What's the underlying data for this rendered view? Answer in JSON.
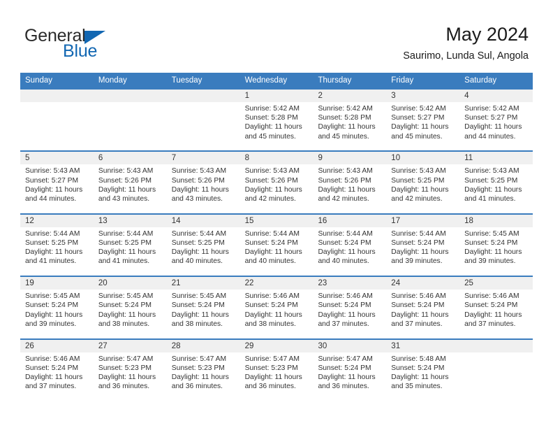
{
  "brand": {
    "name_part1": "General",
    "name_part2": "Blue",
    "triangle_icon": "triangle-icon",
    "color_primary": "#1267b2",
    "color_text": "#2b2b2b"
  },
  "header": {
    "title": "May 2024",
    "subtitle": "Saurimo, Lunda Sul, Angola"
  },
  "theme": {
    "header_row_bg": "#3a7cbe",
    "day_band_bg": "#f0f0f0",
    "text_color": "#333333"
  },
  "weekdays": [
    "Sunday",
    "Monday",
    "Tuesday",
    "Wednesday",
    "Thursday",
    "Friday",
    "Saturday"
  ],
  "weeks": [
    [
      {
        "day": "",
        "sunrise": "",
        "sunset": "",
        "daylight_line1": "",
        "daylight_line2": ""
      },
      {
        "day": "",
        "sunrise": "",
        "sunset": "",
        "daylight_line1": "",
        "daylight_line2": ""
      },
      {
        "day": "",
        "sunrise": "",
        "sunset": "",
        "daylight_line1": "",
        "daylight_line2": ""
      },
      {
        "day": "1",
        "sunrise": "Sunrise: 5:42 AM",
        "sunset": "Sunset: 5:28 PM",
        "daylight_line1": "Daylight: 11 hours",
        "daylight_line2": "and 45 minutes."
      },
      {
        "day": "2",
        "sunrise": "Sunrise: 5:42 AM",
        "sunset": "Sunset: 5:28 PM",
        "daylight_line1": "Daylight: 11 hours",
        "daylight_line2": "and 45 minutes."
      },
      {
        "day": "3",
        "sunrise": "Sunrise: 5:42 AM",
        "sunset": "Sunset: 5:27 PM",
        "daylight_line1": "Daylight: 11 hours",
        "daylight_line2": "and 45 minutes."
      },
      {
        "day": "4",
        "sunrise": "Sunrise: 5:42 AM",
        "sunset": "Sunset: 5:27 PM",
        "daylight_line1": "Daylight: 11 hours",
        "daylight_line2": "and 44 minutes."
      }
    ],
    [
      {
        "day": "5",
        "sunrise": "Sunrise: 5:43 AM",
        "sunset": "Sunset: 5:27 PM",
        "daylight_line1": "Daylight: 11 hours",
        "daylight_line2": "and 44 minutes."
      },
      {
        "day": "6",
        "sunrise": "Sunrise: 5:43 AM",
        "sunset": "Sunset: 5:26 PM",
        "daylight_line1": "Daylight: 11 hours",
        "daylight_line2": "and 43 minutes."
      },
      {
        "day": "7",
        "sunrise": "Sunrise: 5:43 AM",
        "sunset": "Sunset: 5:26 PM",
        "daylight_line1": "Daylight: 11 hours",
        "daylight_line2": "and 43 minutes."
      },
      {
        "day": "8",
        "sunrise": "Sunrise: 5:43 AM",
        "sunset": "Sunset: 5:26 PM",
        "daylight_line1": "Daylight: 11 hours",
        "daylight_line2": "and 42 minutes."
      },
      {
        "day": "9",
        "sunrise": "Sunrise: 5:43 AM",
        "sunset": "Sunset: 5:26 PM",
        "daylight_line1": "Daylight: 11 hours",
        "daylight_line2": "and 42 minutes."
      },
      {
        "day": "10",
        "sunrise": "Sunrise: 5:43 AM",
        "sunset": "Sunset: 5:25 PM",
        "daylight_line1": "Daylight: 11 hours",
        "daylight_line2": "and 42 minutes."
      },
      {
        "day": "11",
        "sunrise": "Sunrise: 5:43 AM",
        "sunset": "Sunset: 5:25 PM",
        "daylight_line1": "Daylight: 11 hours",
        "daylight_line2": "and 41 minutes."
      }
    ],
    [
      {
        "day": "12",
        "sunrise": "Sunrise: 5:44 AM",
        "sunset": "Sunset: 5:25 PM",
        "daylight_line1": "Daylight: 11 hours",
        "daylight_line2": "and 41 minutes."
      },
      {
        "day": "13",
        "sunrise": "Sunrise: 5:44 AM",
        "sunset": "Sunset: 5:25 PM",
        "daylight_line1": "Daylight: 11 hours",
        "daylight_line2": "and 41 minutes."
      },
      {
        "day": "14",
        "sunrise": "Sunrise: 5:44 AM",
        "sunset": "Sunset: 5:25 PM",
        "daylight_line1": "Daylight: 11 hours",
        "daylight_line2": "and 40 minutes."
      },
      {
        "day": "15",
        "sunrise": "Sunrise: 5:44 AM",
        "sunset": "Sunset: 5:24 PM",
        "daylight_line1": "Daylight: 11 hours",
        "daylight_line2": "and 40 minutes."
      },
      {
        "day": "16",
        "sunrise": "Sunrise: 5:44 AM",
        "sunset": "Sunset: 5:24 PM",
        "daylight_line1": "Daylight: 11 hours",
        "daylight_line2": "and 40 minutes."
      },
      {
        "day": "17",
        "sunrise": "Sunrise: 5:44 AM",
        "sunset": "Sunset: 5:24 PM",
        "daylight_line1": "Daylight: 11 hours",
        "daylight_line2": "and 39 minutes."
      },
      {
        "day": "18",
        "sunrise": "Sunrise: 5:45 AM",
        "sunset": "Sunset: 5:24 PM",
        "daylight_line1": "Daylight: 11 hours",
        "daylight_line2": "and 39 minutes."
      }
    ],
    [
      {
        "day": "19",
        "sunrise": "Sunrise: 5:45 AM",
        "sunset": "Sunset: 5:24 PM",
        "daylight_line1": "Daylight: 11 hours",
        "daylight_line2": "and 39 minutes."
      },
      {
        "day": "20",
        "sunrise": "Sunrise: 5:45 AM",
        "sunset": "Sunset: 5:24 PM",
        "daylight_line1": "Daylight: 11 hours",
        "daylight_line2": "and 38 minutes."
      },
      {
        "day": "21",
        "sunrise": "Sunrise: 5:45 AM",
        "sunset": "Sunset: 5:24 PM",
        "daylight_line1": "Daylight: 11 hours",
        "daylight_line2": "and 38 minutes."
      },
      {
        "day": "22",
        "sunrise": "Sunrise: 5:46 AM",
        "sunset": "Sunset: 5:24 PM",
        "daylight_line1": "Daylight: 11 hours",
        "daylight_line2": "and 38 minutes."
      },
      {
        "day": "23",
        "sunrise": "Sunrise: 5:46 AM",
        "sunset": "Sunset: 5:24 PM",
        "daylight_line1": "Daylight: 11 hours",
        "daylight_line2": "and 37 minutes."
      },
      {
        "day": "24",
        "sunrise": "Sunrise: 5:46 AM",
        "sunset": "Sunset: 5:24 PM",
        "daylight_line1": "Daylight: 11 hours",
        "daylight_line2": "and 37 minutes."
      },
      {
        "day": "25",
        "sunrise": "Sunrise: 5:46 AM",
        "sunset": "Sunset: 5:24 PM",
        "daylight_line1": "Daylight: 11 hours",
        "daylight_line2": "and 37 minutes."
      }
    ],
    [
      {
        "day": "26",
        "sunrise": "Sunrise: 5:46 AM",
        "sunset": "Sunset: 5:24 PM",
        "daylight_line1": "Daylight: 11 hours",
        "daylight_line2": "and 37 minutes."
      },
      {
        "day": "27",
        "sunrise": "Sunrise: 5:47 AM",
        "sunset": "Sunset: 5:23 PM",
        "daylight_line1": "Daylight: 11 hours",
        "daylight_line2": "and 36 minutes."
      },
      {
        "day": "28",
        "sunrise": "Sunrise: 5:47 AM",
        "sunset": "Sunset: 5:23 PM",
        "daylight_line1": "Daylight: 11 hours",
        "daylight_line2": "and 36 minutes."
      },
      {
        "day": "29",
        "sunrise": "Sunrise: 5:47 AM",
        "sunset": "Sunset: 5:23 PM",
        "daylight_line1": "Daylight: 11 hours",
        "daylight_line2": "and 36 minutes."
      },
      {
        "day": "30",
        "sunrise": "Sunrise: 5:47 AM",
        "sunset": "Sunset: 5:24 PM",
        "daylight_line1": "Daylight: 11 hours",
        "daylight_line2": "and 36 minutes."
      },
      {
        "day": "31",
        "sunrise": "Sunrise: 5:48 AM",
        "sunset": "Sunset: 5:24 PM",
        "daylight_line1": "Daylight: 11 hours",
        "daylight_line2": "and 35 minutes."
      },
      {
        "day": "",
        "sunrise": "",
        "sunset": "",
        "daylight_line1": "",
        "daylight_line2": ""
      }
    ]
  ]
}
